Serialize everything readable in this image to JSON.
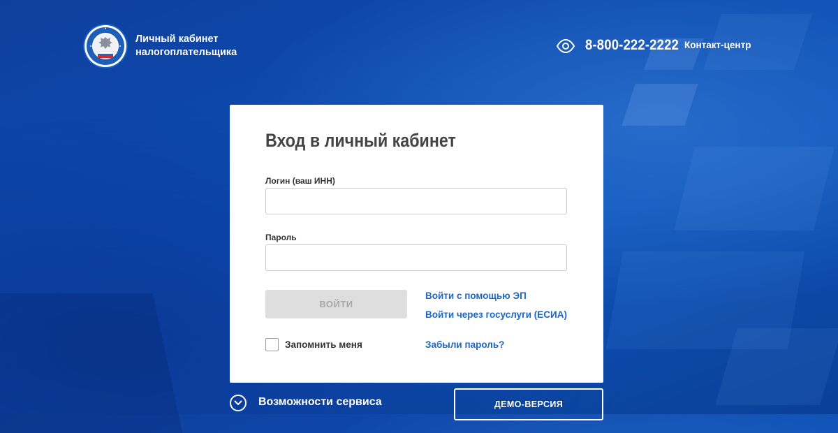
{
  "header": {
    "brand_line1": "Личный кабинет",
    "brand_line2": "налогоплательщика",
    "logo_ring_text": "ФЕДЕРАЛЬНАЯ НАЛОГОВАЯ СЛУЖБА",
    "phone": "8-800-222-2222",
    "contact_label": "Контакт-центр",
    "accessibility_icon": "eye-icon"
  },
  "login_card": {
    "title": "Вход в личный кабинет",
    "login_label": "Логин (ваш ИНН)",
    "login_value": "",
    "password_label": "Пароль",
    "password_value": "",
    "submit_label": "ВОЙТИ",
    "link_ep": "Войти с помощью ЭП",
    "link_esia": "Войти через госуслуги (ЕСИА)",
    "remember_label": "Запомнить меня",
    "remember_checked": false,
    "forgot_label": "Забыли пароль?"
  },
  "footer": {
    "features_label": "Возможности сервиса",
    "features_icon": "chevron-down-icon",
    "demo_label": "ДЕМО-ВЕРСИЯ"
  },
  "colors": {
    "background": "#0b4cb0",
    "link": "#1f67c4",
    "button_disabled_bg": "#dedede",
    "button_disabled_text": "#a9a9a9"
  }
}
